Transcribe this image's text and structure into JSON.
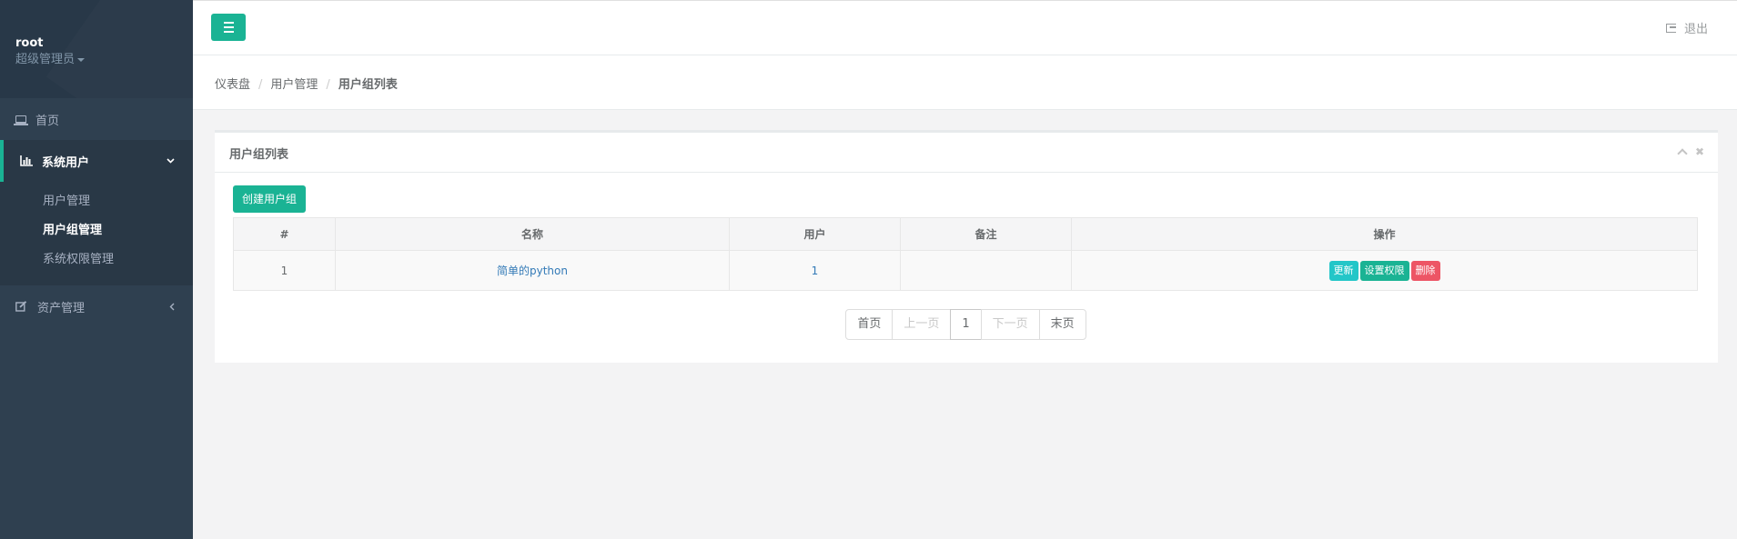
{
  "sidebar": {
    "username": "root",
    "role": "超级管理员",
    "items": [
      {
        "label": "首页"
      },
      {
        "label": "系统用户",
        "sub": [
          "用户管理",
          "用户组管理",
          "系统权限管理"
        ]
      },
      {
        "label": "资产管理"
      }
    ]
  },
  "header": {
    "logout_label": "退出"
  },
  "breadcrumb": [
    "仪表盘",
    "用户管理",
    "用户组列表"
  ],
  "panel": {
    "title": "用户组列表",
    "create_button": "创建用户组"
  },
  "table": {
    "headers": [
      "#",
      "名称",
      "用户",
      "备注",
      "操作"
    ],
    "rows": [
      {
        "index": "1",
        "name": "简单的python",
        "users": "1",
        "note": ""
      }
    ],
    "actions": {
      "update": "更新",
      "set_perm": "设置权限",
      "delete": "删除"
    }
  },
  "pagination": {
    "first": "首页",
    "prev": "上一页",
    "current": "1",
    "next": "下一页",
    "last": "末页"
  },
  "colors": {
    "sidebar_bg": "#2f4050",
    "primary": "#1ab394",
    "info": "#23c6c8",
    "danger": "#ed5565",
    "link": "#337ab7"
  }
}
